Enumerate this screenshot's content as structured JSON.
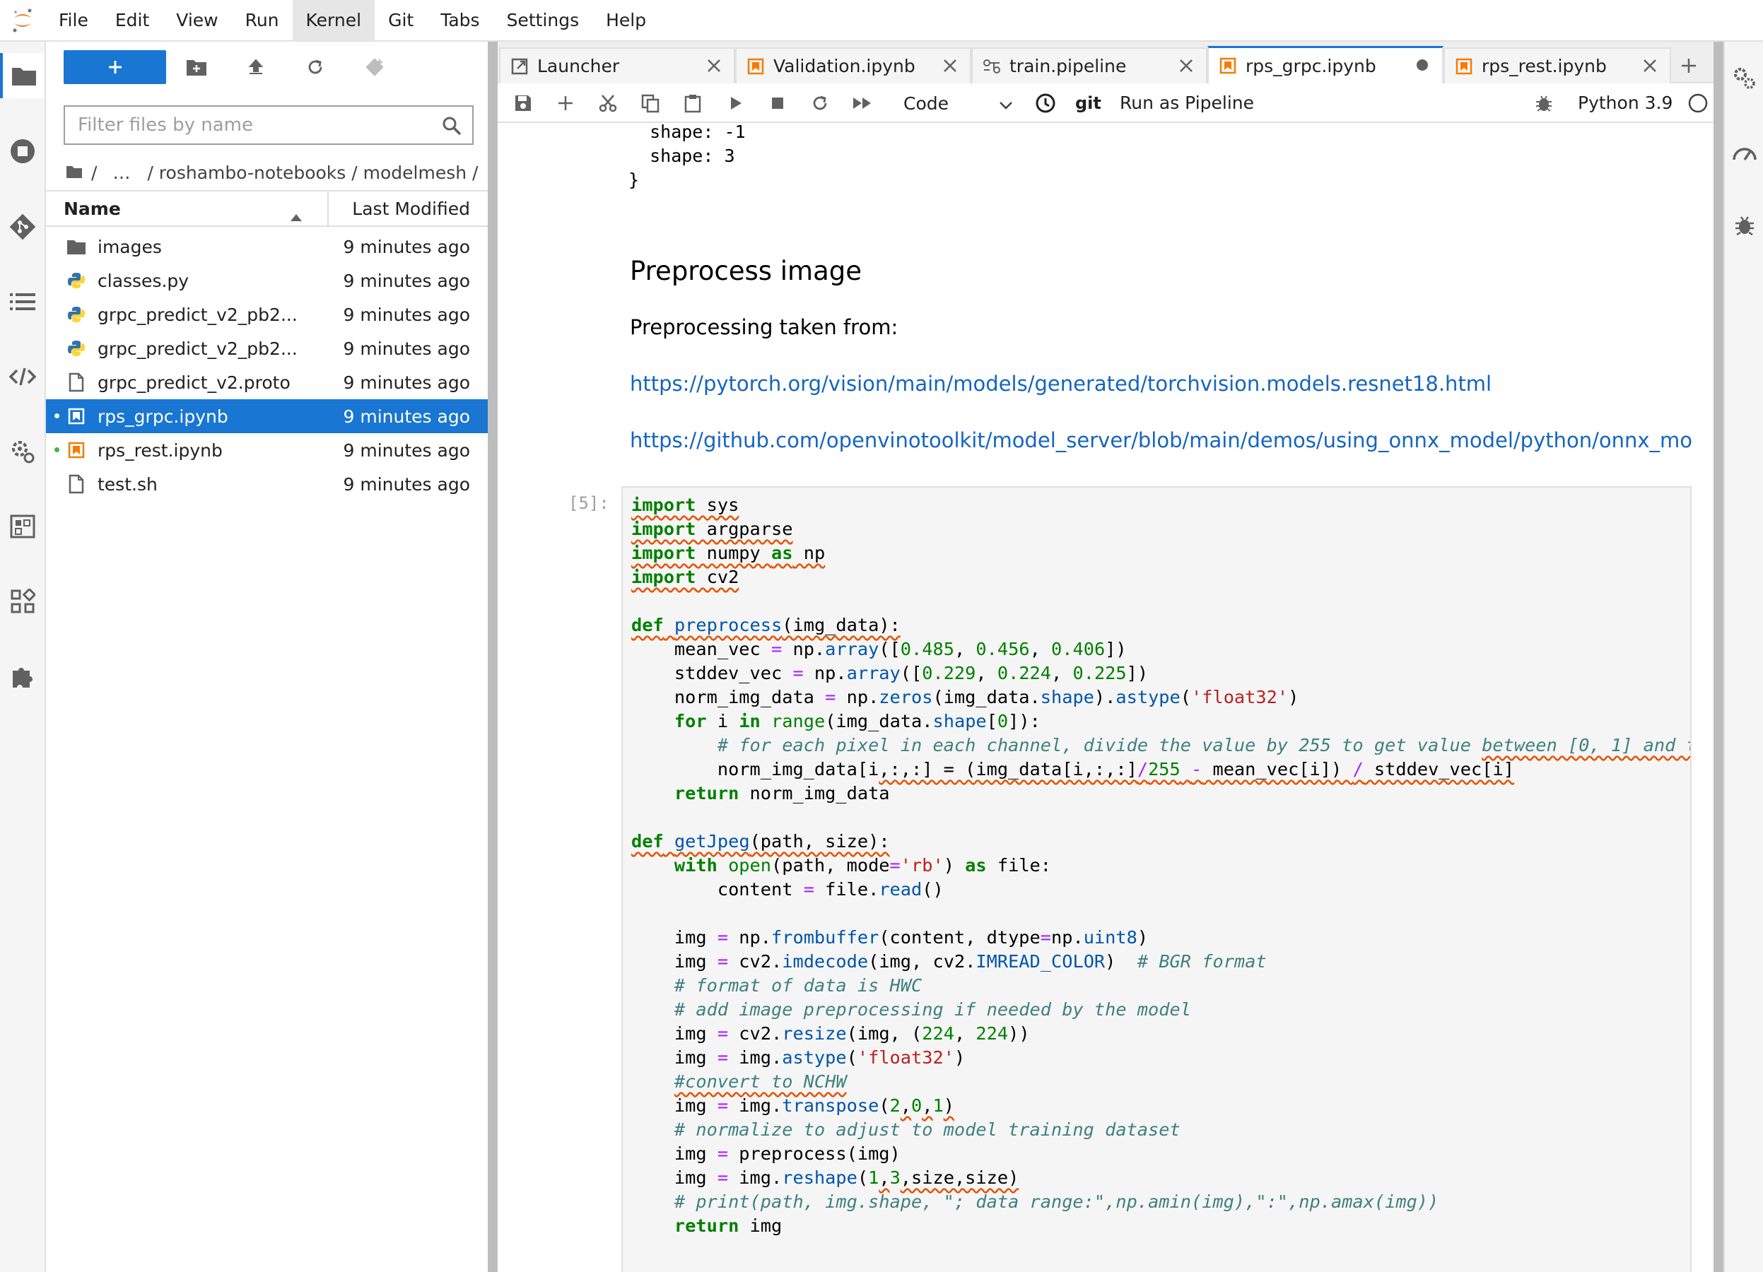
{
  "menubar": {
    "items": [
      "File",
      "Edit",
      "View",
      "Run",
      "Kernel",
      "Git",
      "Tabs",
      "Settings",
      "Help"
    ]
  },
  "filebrowser": {
    "filter_placeholder": "Filter files by name",
    "breadcrumb": {
      "root": "/",
      "ellipsis": "…",
      "path": "/ roshambo-notebooks / modelmesh /"
    },
    "columns": {
      "name": "Name",
      "modified": "Last Modified"
    },
    "files": [
      {
        "name": "images",
        "modified": "9 minutes ago",
        "type": "folder",
        "running": false,
        "selected": false
      },
      {
        "name": "classes.py",
        "modified": "9 minutes ago",
        "type": "python",
        "running": false,
        "selected": false
      },
      {
        "name": "grpc_predict_v2_pb2...",
        "modified": "9 minutes ago",
        "type": "python",
        "running": false,
        "selected": false
      },
      {
        "name": "grpc_predict_v2_pb2...",
        "modified": "9 minutes ago",
        "type": "python",
        "running": false,
        "selected": false
      },
      {
        "name": "grpc_predict_v2.proto",
        "modified": "9 minutes ago",
        "type": "file",
        "running": false,
        "selected": false
      },
      {
        "name": "rps_grpc.ipynb",
        "modified": "9 minutes ago",
        "type": "notebook",
        "running": true,
        "selected": true
      },
      {
        "name": "rps_rest.ipynb",
        "modified": "9 minutes ago",
        "type": "notebook",
        "running": true,
        "selected": false
      },
      {
        "name": "test.sh",
        "modified": "9 minutes ago",
        "type": "file",
        "running": false,
        "selected": false
      }
    ]
  },
  "tabs": [
    {
      "label": "Launcher",
      "icon": "launcher-icon",
      "active": false
    },
    {
      "label": "Validation.ipynb",
      "icon": "notebook-icon",
      "active": false
    },
    {
      "label": "train.pipeline",
      "icon": "pipeline-icon",
      "active": false
    },
    {
      "label": "rps_grpc.ipynb",
      "icon": "notebook-icon",
      "active": true
    },
    {
      "label": "rps_rest.ipynb",
      "icon": "notebook-icon",
      "active": false
    }
  ],
  "toolbar": {
    "cell_type": "Code",
    "git": "git",
    "run_pipeline": "Run as Pipeline",
    "kernel": "Python 3.9"
  },
  "notebook": {
    "prev_output_lines": [
      "  shape: -1",
      "  shape: 3",
      "}"
    ],
    "heading": "Preprocess image",
    "paragraph": "Preprocessing taken from:",
    "link1": "https://pytorch.org/vision/main/models/generated/torchvision.models.resnet18.html",
    "link2": "https://github.com/openvinotoolkit/model_server/blob/main/demos/using_onnx_model/python/onnx_mo",
    "cell_prompt": "[5]:"
  },
  "colors": {
    "accent": "#1976d2",
    "notebook_icon": "#f57c00",
    "python_blue": "#3572a5",
    "python_yellow": "#ffd43b",
    "running_dot": "#4caf50"
  }
}
